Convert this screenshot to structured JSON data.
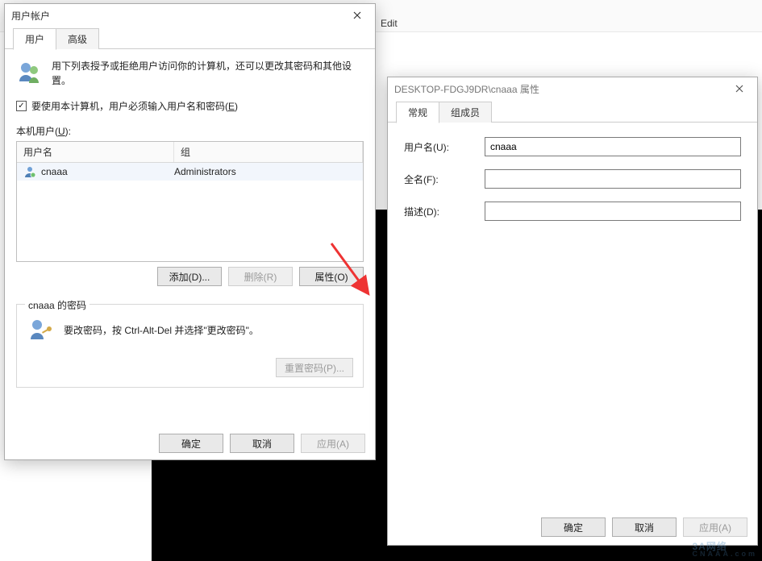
{
  "background": {
    "menu": "Edit"
  },
  "left": {
    "title": "用户帐户",
    "tabs": {
      "t1": "用户",
      "t2": "高级"
    },
    "intro": "用下列表授予或拒绝用户访问你的计算机，还可以更改其密码和其他设置。",
    "require_label_a": "要使用本计算机，用户必须输入用户名和密码(",
    "require_label_u": "E",
    "require_label_b": ")",
    "require_checked": true,
    "list_label_a": "本机用户(",
    "list_label_u": "U",
    "list_label_b": "):",
    "head": {
      "user": "用户名",
      "group": "组"
    },
    "rows": [
      {
        "name": "cnaaa",
        "group": "Administrators"
      }
    ],
    "btns": {
      "add": "添加(D)...",
      "del": "删除(R)",
      "prop": "属性(O)"
    },
    "fs": {
      "legend": "cnaaa 的密码",
      "text": "要改密码，按 Ctrl-Alt-Del 并选择\"更改密码\"。",
      "reset": "重置密码(P)..."
    },
    "dlg": {
      "ok": "确定",
      "cancel": "取消",
      "apply": "应用(A)"
    }
  },
  "right": {
    "title": "DESKTOP-FDGJ9DR\\cnaaa 属性",
    "tabs": {
      "t1": "常规",
      "t2": "组成员"
    },
    "labels": {
      "username": "用户名(U):",
      "fullname": "全名(F):",
      "desc": "描述(D):"
    },
    "values": {
      "username": "cnaaa",
      "fullname": "",
      "desc": ""
    },
    "dlg": {
      "ok": "确定",
      "cancel": "取消",
      "apply": "应用(A)"
    }
  },
  "watermark": {
    "main": "3A网络",
    "sub": "CNAAA.com"
  }
}
